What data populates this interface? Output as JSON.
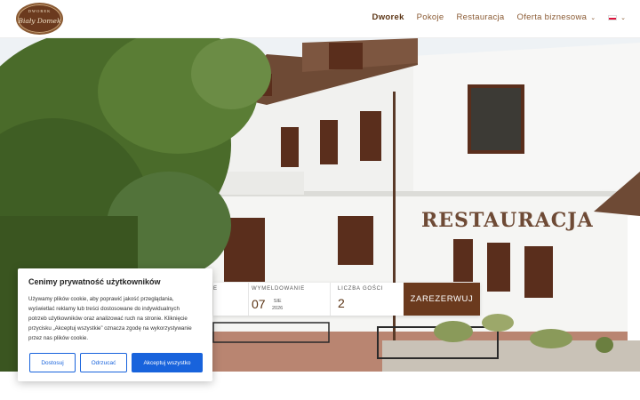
{
  "header": {
    "logo": {
      "top": "DWOREK",
      "main": "Biały Domek"
    },
    "nav": [
      {
        "label": "Dworek",
        "active": true
      },
      {
        "label": "Pokoje"
      },
      {
        "label": "Restauracja"
      },
      {
        "label": "Oferta biznesowa",
        "has_dropdown": true
      }
    ],
    "language": "pl"
  },
  "hero": {
    "sign_text": "RESTAURACJA"
  },
  "booking": {
    "checkin_label_partial": "E",
    "checkout_label": "WYMELDOWANIE",
    "checkout_day": "07",
    "checkout_month": "SIE",
    "checkout_year": "2026",
    "guests_label": "LICZBA GOŚCI",
    "guests_value": "2",
    "submit_label": "ZAREZERWUJ"
  },
  "cookie": {
    "title": "Cenimy prywatność użytkowników",
    "text_lines": [
      "Używamy plików cookie, aby poprawić jakość przeglądania,",
      "wyświetlać reklamy lub treści dostosowane do indywidualnych",
      "potrzeb użytkowników oraz analizować ruch na stronie. Kliknięcie",
      "przycisku „Akceptuj wszystkie” oznacza zgodę na wykorzystywanie",
      "przez nas plików cookie."
    ],
    "btn_customize": "Dostosuj",
    "btn_reject": "Odrzucać",
    "btn_accept": "Akceptuj wszystko"
  },
  "colors": {
    "brand_brown": "#6b3a1e",
    "nav_brown": "#8a5a33",
    "cookie_blue": "#1863dc"
  }
}
